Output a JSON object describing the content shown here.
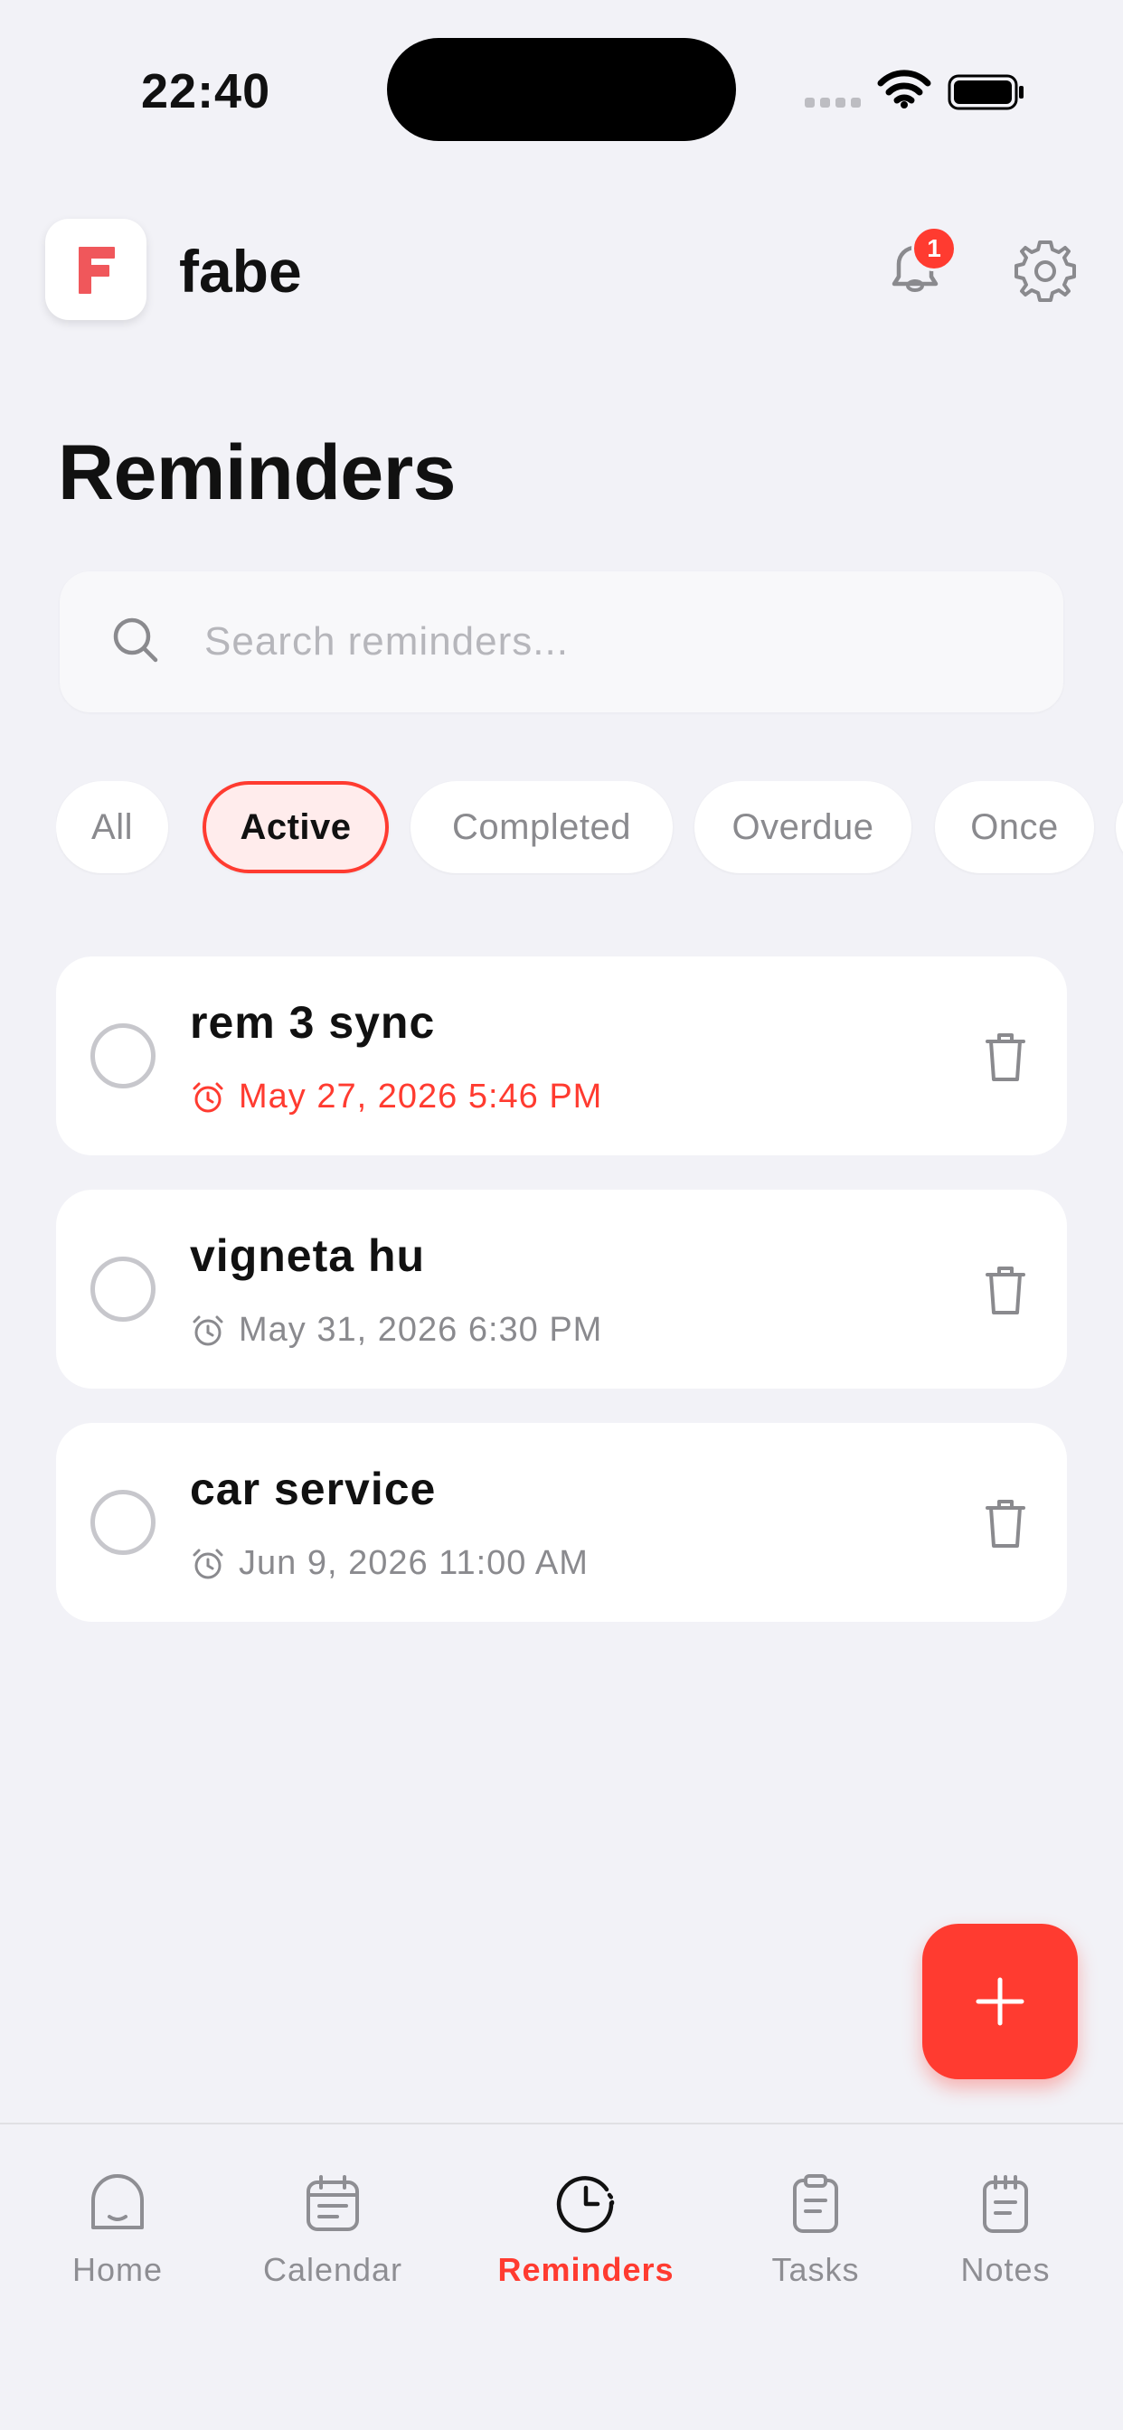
{
  "status_bar": {
    "time": "22:40"
  },
  "header": {
    "app_name": "fabe",
    "notification_count": "1"
  },
  "page": {
    "title": "Reminders"
  },
  "search": {
    "placeholder": "Search reminders..."
  },
  "filters": [
    "All",
    "Active",
    "Completed",
    "Overdue",
    "Once"
  ],
  "selected_filter": "Active",
  "reminders": [
    {
      "title": "rem 3 sync",
      "datetime": "May 27, 2026 5:46 PM",
      "overdue": true
    },
    {
      "title": "vigneta hu",
      "datetime": "May 31, 2026 6:30 PM",
      "overdue": false
    },
    {
      "title": "car service",
      "datetime": "Jun 9, 2026 11:00 AM",
      "overdue": false
    }
  ],
  "tabs": [
    {
      "label": "Home",
      "icon": "home-icon"
    },
    {
      "label": "Calendar",
      "icon": "calendar-icon"
    },
    {
      "label": "Reminders",
      "icon": "clock-icon"
    },
    {
      "label": "Tasks",
      "icon": "clipboard-icon"
    },
    {
      "label": "Notes",
      "icon": "notepad-icon"
    }
  ],
  "active_tab": "Reminders",
  "colors": {
    "accent": "#FF3B30",
    "background": "#F2F2F7",
    "muted": "#8E8E93"
  }
}
